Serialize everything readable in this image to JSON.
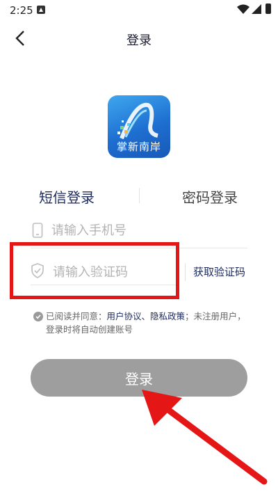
{
  "status_bar": {
    "time": "2:25"
  },
  "header": {
    "title": "登录"
  },
  "logo": {
    "text": "掌新南岸"
  },
  "tabs": [
    {
      "label": "短信登录",
      "active": true
    },
    {
      "label": "密码登录",
      "active": false
    }
  ],
  "phone": {
    "placeholder": "请输入手机号",
    "value": ""
  },
  "code": {
    "placeholder": "请输入验证码",
    "value": "",
    "get_code_label": "获取验证码"
  },
  "agreement": {
    "prefix": "已阅读并同意：",
    "user_agreement": "用户协议",
    "separator": "、",
    "privacy_policy": "隐私政策",
    "suffix": "；未注册用户，登录时将自动创建账号",
    "checked": true
  },
  "login_button": {
    "label": "登录"
  },
  "colors": {
    "accent": "#1c2a5e",
    "annotation": "#e51616",
    "button": "#9e9e9e"
  }
}
